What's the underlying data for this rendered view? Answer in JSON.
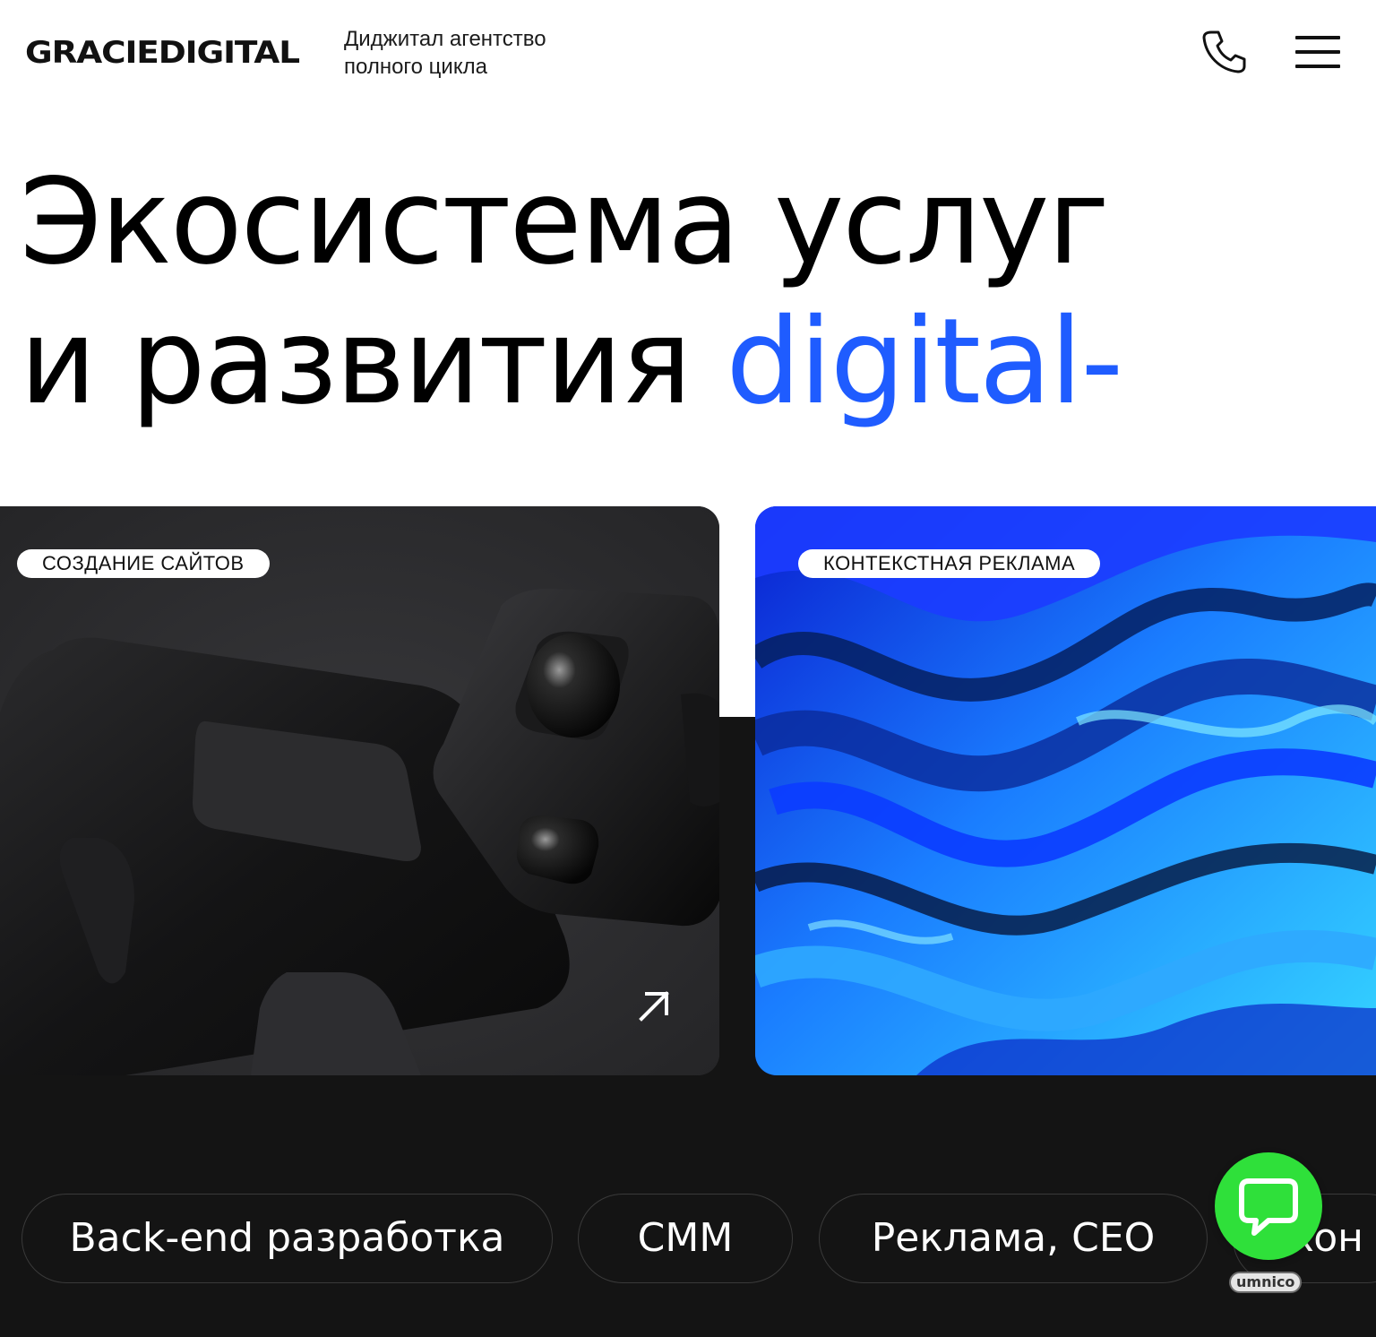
{
  "header": {
    "logo_text": "GRACIEDIGITAL",
    "tagline": "Диджитал агентство\nполного цикла",
    "phone_icon": "phone-icon",
    "menu_icon": "hamburger-menu-icon"
  },
  "hero": {
    "line1": "Экосистема услуг",
    "line2_prefix": "и развития ",
    "line2_accent": "digital-",
    "accent_color": "#1f5cff"
  },
  "cards": [
    {
      "tag": "СОЗДАНИЕ САЙТОВ",
      "icon": "arrow-up-right-icon"
    },
    {
      "tag": "КОНТЕКСТНАЯ РЕКЛАМА"
    }
  ],
  "services": [
    {
      "label": "Back-end разработка"
    },
    {
      "label": "СММ"
    },
    {
      "label": "Реклама, СЕО"
    },
    {
      "label": "Кон"
    }
  ],
  "chat_widget": {
    "icon": "chat-bubble-icon",
    "brand": "umnico",
    "color": "#2fe03a"
  },
  "colors": {
    "dark_background": "#141414",
    "accent": "#1f5cff"
  }
}
